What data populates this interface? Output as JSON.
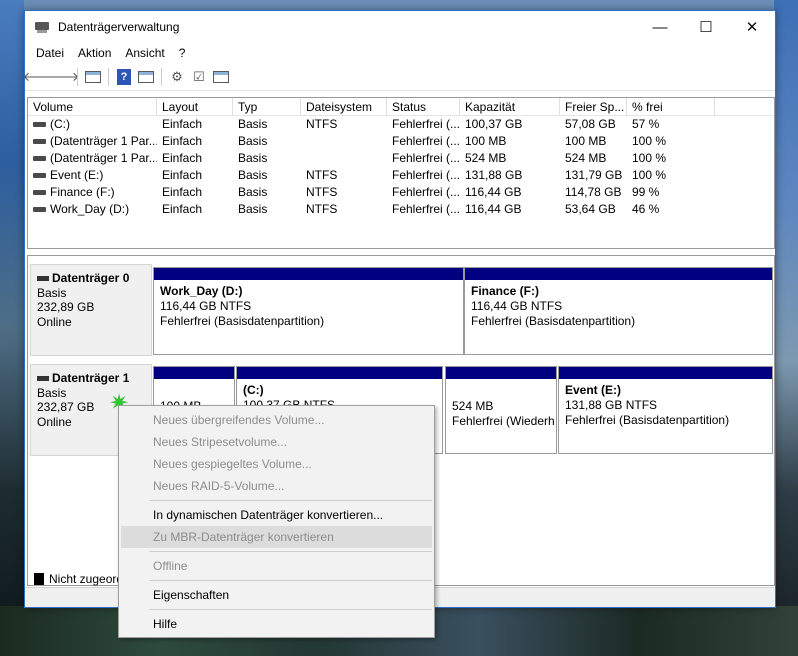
{
  "window": {
    "title": "Datenträgerverwaltung",
    "minimize": "—",
    "maximize": "☐",
    "close": "✕"
  },
  "menu": [
    "Datei",
    "Aktion",
    "Ansicht",
    "?"
  ],
  "columns": [
    "Volume",
    "Layout",
    "Typ",
    "Dateisystem",
    "Status",
    "Kapazität",
    "Freier Sp...",
    "% frei"
  ],
  "volumes": [
    [
      "(C:)",
      "Einfach",
      "Basis",
      "NTFS",
      "Fehlerfrei (...",
      "100,37 GB",
      "57,08 GB",
      "57 %"
    ],
    [
      "(Datenträger 1 Par...",
      "Einfach",
      "Basis",
      "",
      "Fehlerfrei (...",
      "100 MB",
      "100 MB",
      "100 %"
    ],
    [
      "(Datenträger 1 Par...",
      "Einfach",
      "Basis",
      "",
      "Fehlerfrei (...",
      "524 MB",
      "524 MB",
      "100 %"
    ],
    [
      "Event (E:)",
      "Einfach",
      "Basis",
      "NTFS",
      "Fehlerfrei (...",
      "131,88 GB",
      "131,79 GB",
      "100 %"
    ],
    [
      "Finance (F:)",
      "Einfach",
      "Basis",
      "NTFS",
      "Fehlerfrei (...",
      "116,44 GB",
      "114,78 GB",
      "99 %"
    ],
    [
      "Work_Day (D:)",
      "Einfach",
      "Basis",
      "NTFS",
      "Fehlerfrei (...",
      "116,44 GB",
      "53,64 GB",
      "46 %"
    ]
  ],
  "disk0": {
    "name": "Datenträger 0",
    "type": "Basis",
    "size": "232,89 GB",
    "state": "Online",
    "p1": {
      "name": "Work_Day  (D:)",
      "size": "116,44 GB NTFS",
      "status": "Fehlerfrei (Basisdatenpartition)"
    },
    "p2": {
      "name": "Finance  (F:)",
      "size": "116,44 GB NTFS",
      "status": "Fehlerfrei (Basisdatenpartition)"
    }
  },
  "disk1": {
    "name": "Datenträger 1",
    "type": "Basis",
    "size": "232,87 GB",
    "state": "Online",
    "p1": {
      "size": "100 MB"
    },
    "p2": {
      "name": "(C:)",
      "size": "100,37 GB NTFS"
    },
    "p3": {
      "size": "524 MB",
      "status": "Fehlerfrei (Wiederh"
    },
    "p4": {
      "name": "Event  (E:)",
      "size": "131,88 GB NTFS",
      "status": "Fehlerfrei (Basisdatenpartition)"
    }
  },
  "legend": {
    "unallocated": "Nicht zugeord"
  },
  "context_menu": {
    "spanned": "Neues übergreifendes Volume...",
    "striped": "Neues Stripesetvolume...",
    "mirrored": "Neues gespiegeltes Volume...",
    "raid5": "Neues RAID-5-Volume...",
    "to_dynamic": "In dynamischen Datenträger konvertieren...",
    "to_mbr": "Zu MBR-Datenträger konvertieren",
    "offline": "Offline",
    "properties": "Eigenschaften",
    "help": "Hilfe"
  },
  "colors": {
    "partition_bar": "#000080",
    "accent": "#2b6fc9",
    "gear": "#33c433"
  }
}
